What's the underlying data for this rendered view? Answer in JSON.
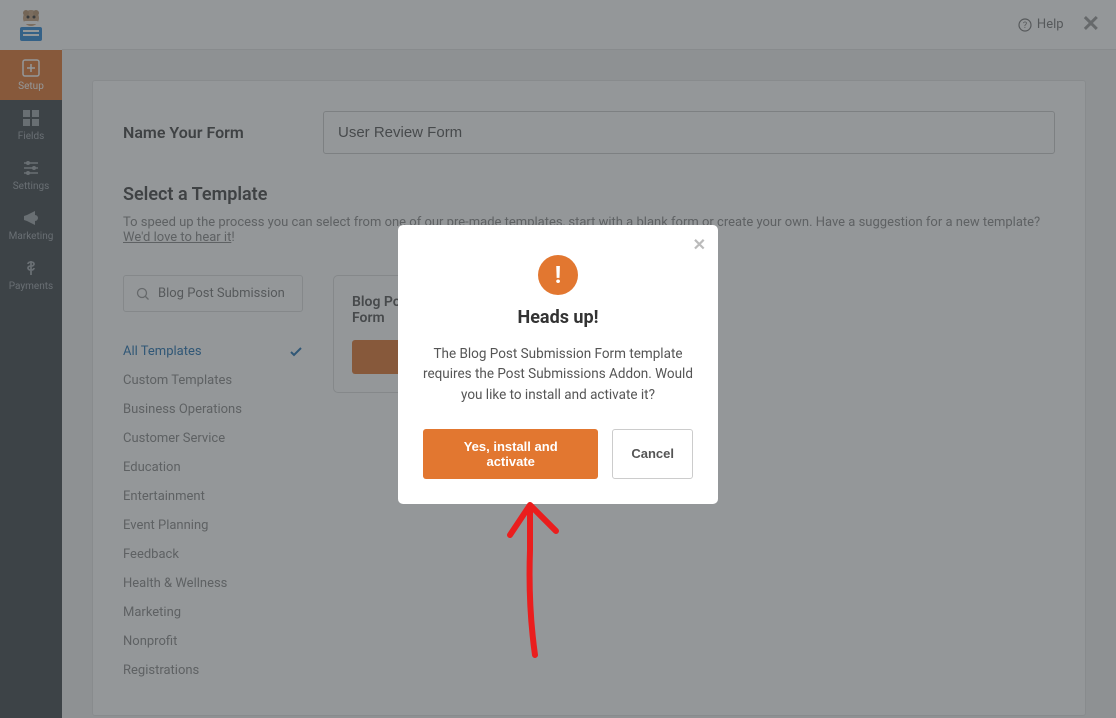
{
  "sidebar": {
    "items": [
      {
        "label": "Setup"
      },
      {
        "label": "Fields"
      },
      {
        "label": "Settings"
      },
      {
        "label": "Marketing"
      },
      {
        "label": "Payments"
      }
    ]
  },
  "topbar": {
    "help_label": "Help"
  },
  "form": {
    "name_label": "Name Your Form",
    "name_value": "User Review Form"
  },
  "templates": {
    "title": "Select a Template",
    "subtitle_pre": "To speed up the process you can select from one of our pre-made templates, start with a blank form or create your own. Have a suggestion for a new template? ",
    "subtitle_link": "We'd love to hear it",
    "subtitle_post": "!",
    "search_value": "Blog Post Submission",
    "categories": [
      "All Templates",
      "Custom Templates",
      "Business Operations",
      "Customer Service",
      "Education",
      "Entertainment",
      "Event Planning",
      "Feedback",
      "Health & Wellness",
      "Marketing",
      "Nonprofit",
      "Registrations"
    ],
    "card_title": "Blog Post Submission Form"
  },
  "modal": {
    "title": "Heads up!",
    "text": "The Blog Post Submission Form template requires the Post Submissions Addon. Would you like to install and activate it?",
    "confirm_label": "Yes, install and activate",
    "cancel_label": "Cancel"
  }
}
